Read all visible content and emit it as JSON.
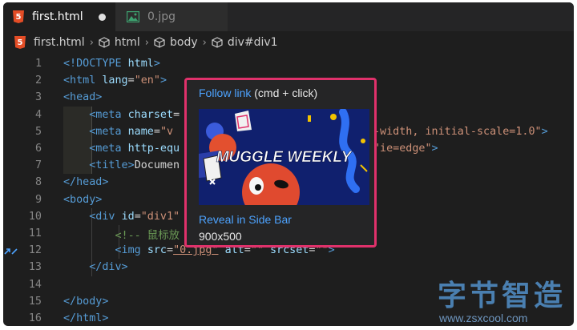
{
  "tabs": [
    {
      "label": "first.html",
      "active": true,
      "modified": true
    },
    {
      "label": "0.jpg",
      "active": false
    }
  ],
  "breadcrumb": [
    "first.html",
    "html",
    "body",
    "div#div1"
  ],
  "code": [
    {
      "n": "1",
      "t": [
        [
          "tg",
          "<!DOCTYPE "
        ],
        [
          "at",
          "html"
        ],
        [
          "tg",
          ">"
        ]
      ]
    },
    {
      "n": "2",
      "t": [
        [
          "tg",
          "<html "
        ],
        [
          "at",
          "lang"
        ],
        [
          "pl",
          "="
        ],
        [
          "st",
          "\"en\""
        ],
        [
          "tg",
          ">"
        ]
      ]
    },
    {
      "n": "3",
      "t": [
        [
          "tg",
          "<head>"
        ]
      ]
    },
    {
      "n": "4",
      "t": [
        [
          "pl",
          "    "
        ],
        [
          "tg",
          "<meta "
        ],
        [
          "at",
          "charset"
        ],
        [
          "pl",
          "="
        ]
      ]
    },
    {
      "n": "5",
      "t": [
        [
          "pl",
          "    "
        ],
        [
          "tg",
          "<meta "
        ],
        [
          "at",
          "name"
        ],
        [
          "pl",
          "="
        ],
        [
          "st",
          "\"v"
        ],
        [
          "pl",
          "                             "
        ],
        [
          "st",
          "ce-width, initial-scale=1.0\""
        ],
        [
          "tg",
          ">"
        ]
      ]
    },
    {
      "n": "6",
      "t": [
        [
          "pl",
          "    "
        ],
        [
          "tg",
          "<meta "
        ],
        [
          "at",
          "http-equ"
        ],
        [
          "pl",
          "                            "
        ],
        [
          "at",
          "t"
        ],
        [
          "pl",
          "="
        ],
        [
          "st",
          "\"ie=edge\""
        ],
        [
          "tg",
          ">"
        ]
      ]
    },
    {
      "n": "7",
      "t": [
        [
          "pl",
          "    "
        ],
        [
          "tg",
          "<title>"
        ],
        [
          "pl",
          "Documen"
        ]
      ]
    },
    {
      "n": "8",
      "t": [
        [
          "tg",
          "</head>"
        ]
      ]
    },
    {
      "n": "9",
      "t": [
        [
          "tg",
          "<body>"
        ]
      ]
    },
    {
      "n": "10",
      "t": [
        [
          "pl",
          "    "
        ],
        [
          "tg",
          "<div "
        ],
        [
          "at",
          "id"
        ],
        [
          "pl",
          "="
        ],
        [
          "st",
          "\"div1\""
        ]
      ]
    },
    {
      "n": "11",
      "t": [
        [
          "pl",
          "        "
        ],
        [
          "cm",
          "<!-- 鼠标放"
        ]
      ]
    },
    {
      "n": "12",
      "t": [
        [
          "pl",
          "        "
        ],
        [
          "tg",
          "<img "
        ],
        [
          "at",
          "src"
        ],
        [
          "pl",
          "="
        ],
        [
          "st",
          "\"0.jpg\""
        ],
        [
          "pl",
          " "
        ],
        [
          "at",
          "alt"
        ],
        [
          "pl",
          "="
        ],
        [
          "st",
          "\"\""
        ],
        [
          "pl",
          " "
        ],
        [
          "at",
          "srcset"
        ],
        [
          "pl",
          "="
        ],
        [
          "st",
          "\"\""
        ],
        [
          "tg",
          ">"
        ]
      ]
    },
    {
      "n": "13",
      "t": [
        [
          "pl",
          "    "
        ],
        [
          "tg",
          "</div>"
        ]
      ]
    },
    {
      "n": "14",
      "t": []
    },
    {
      "n": "15",
      "t": [
        [
          "tg",
          "</body>"
        ]
      ]
    },
    {
      "n": "16",
      "t": [
        [
          "tg",
          "</html>"
        ]
      ]
    }
  ],
  "popup": {
    "follow_link": "Follow link",
    "follow_hint": " (cmd + click)",
    "image_text": "MUGGLE WEEKLY",
    "reveal": "Reveal in Side Bar",
    "size": "900x500"
  },
  "watermark": {
    "cn": "字节智造",
    "url": "www.zsxcool.com"
  },
  "colors": {
    "editor_bg": "#1e1e1e",
    "accent": "#e0316b",
    "link": "#4da3ff"
  }
}
